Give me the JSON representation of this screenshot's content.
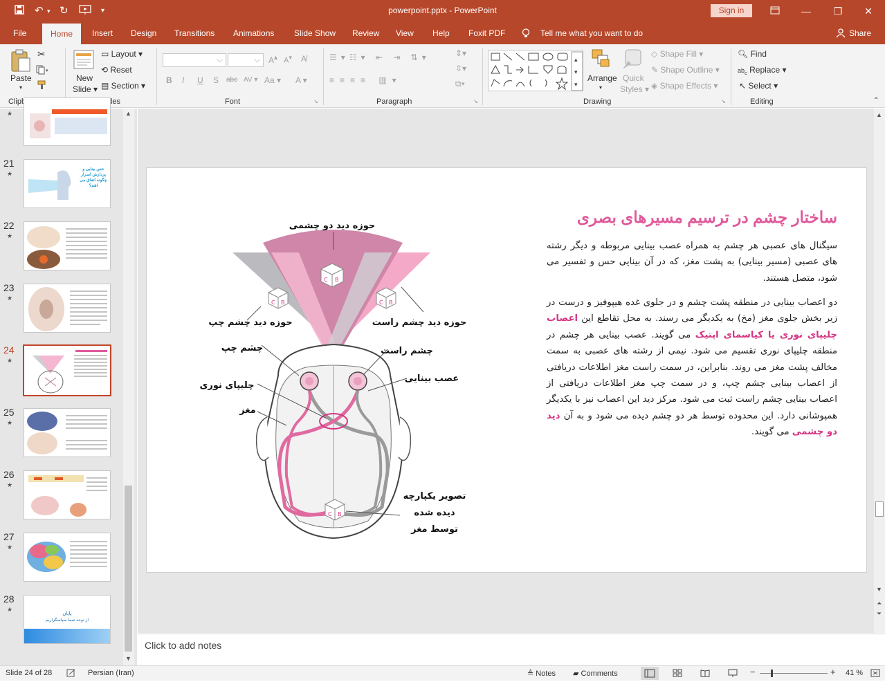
{
  "app": {
    "doc_title": "powerpoint.pptx",
    "app_name": "PowerPoint",
    "sign_in": "Sign in"
  },
  "tabs": [
    "File",
    "Home",
    "Insert",
    "Design",
    "Transitions",
    "Animations",
    "Slide Show",
    "Review",
    "View",
    "Help",
    "Foxit PDF",
    "Tell me what you want to do",
    "Share"
  ],
  "ribbon": {
    "clipboard": {
      "paste": "Paste",
      "label": "Clipboard"
    },
    "slides": {
      "new_slide_1": "New",
      "new_slide_2": "Slide",
      "layout": "Layout",
      "reset": "Reset",
      "section": "Section",
      "label": "Slides"
    },
    "font": {
      "label": "Font",
      "bold": "B",
      "italic": "I",
      "underline": "U",
      "shadow": "S",
      "strike": "abc",
      "spacing": "AV",
      "case": "Aa",
      "color": "A"
    },
    "paragraph": {
      "label": "Paragraph"
    },
    "drawing": {
      "arrange": "Arrange",
      "quick_1": "Quick",
      "quick_2": "Styles",
      "shape_fill": "Shape Fill",
      "shape_outline": "Shape Outline",
      "shape_effects": "Shape Effects",
      "label": "Drawing"
    },
    "editing": {
      "find": "Find",
      "replace": "Replace",
      "select": "Select",
      "label": "Editing"
    }
  },
  "thumbnails": [
    {
      "num": "",
      "star": "★"
    },
    {
      "num": "21",
      "star": "★",
      "text": "حس بینایی و پردازش اسرار چگونه اتفاق می افتد؟"
    },
    {
      "num": "22",
      "star": "★"
    },
    {
      "num": "23",
      "star": "★"
    },
    {
      "num": "24",
      "star": "★"
    },
    {
      "num": "25",
      "star": "★"
    },
    {
      "num": "26",
      "star": "★"
    },
    {
      "num": "27",
      "star": "★"
    },
    {
      "num": "28",
      "star": "★",
      "text1": "پایان",
      "text2": "از توجه شما سپاسگزاریم"
    }
  ],
  "slide": {
    "title": "ساختار چشم در ترسیم مسیرهای بصری",
    "para1": "سیگنال های عصبی هر چشم به همراه عصب بینایی مربوطه و دیگر رشته های عصبی (مسیر بینایی) به پشت مغز، که در آن بینایی حس و تفسیر می شود، متصل هستند.",
    "para2_a": "دو اعصاب بینایی در منطقه پشت چشم و در جلوی غده هیپوفیز و درست در زیر بخش جلوی مغز (مخ) به یکدیگر می رسند. به محل تقاطع این ",
    "para2_hl1": "اعصاب چلیپای نوری یا کیاسمای اپتیک",
    "para2_b": " می گویند. عصب بینایی هر چشم در منطقه چلیپای نوری تقسیم می شود. نیمی از رشته های عصبی به سمت مخالف پشت مغز می روند. بنابراین، در سمت راست مغز اطلاعات دریافتی از اعصاب بینایی چشم چپ، و در سمت چپ مغز اطلاعات دریافتی از اعصاب بینایی چشم راست ثبت می شود. مرکز دید این اعصاب نیز با یکدیگر همپوشانی دارد. این محدوده توسط هر دو چشم دیده می شود و به آن ",
    "para2_hl2": "دید دو چشمی",
    "para2_c": " می گویند.",
    "diagram": {
      "binocular": "حوزه دید دو چشمی",
      "left_field": "حوزه دید چشم چپ",
      "right_field": "حوزه دید چشم راست",
      "left_eye": "چشم چپ",
      "right_eye": "چشم راست",
      "optic_nerve": "عصب بینایی",
      "chiasm": "چلیپای نوری",
      "brain": "مغز",
      "image_1": "تصویر یکپارچه",
      "image_2": "دیده شده",
      "image_3": "توسط مغز",
      "cube_c": "C",
      "cube_b": "B"
    }
  },
  "notes_placeholder": "Click to add notes",
  "status": {
    "slide_info": "Slide 24 of 28",
    "language": "Persian (Iran)",
    "notes": "Notes",
    "comments": "Comments",
    "zoom": "41 %"
  },
  "colors": {
    "accent": "#b7472a",
    "pink": "#e05a9c",
    "field_pink": "#f4a7c8",
    "field_gray": "#b9b9bd",
    "binocular": "#cf7ea3"
  }
}
